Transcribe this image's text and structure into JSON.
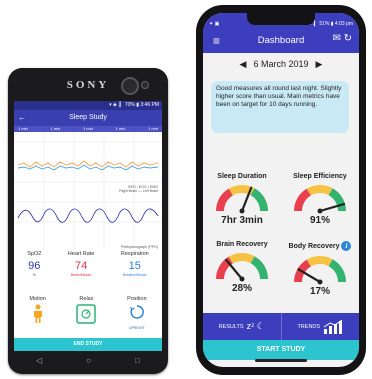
{
  "left_phone": {
    "brand": "SONY",
    "status_time": "▾ ◈ .▎ 70% ▮ 3:46 PM",
    "app_title": "Sleep Study",
    "back_glyph": "←",
    "tab_labels": [
      "1 min",
      "1 min",
      "1 min",
      "1 min",
      "1 min"
    ],
    "legend_line1": "EEG / EOG / EMG",
    "legend_line2": "Right Brain  —  Left Brain",
    "ppg_label": "Plethysmograph (PPG)",
    "metrics": [
      {
        "label": "SpO2",
        "value": "96",
        "unit": "%",
        "color": "#2e3aa8"
      },
      {
        "label": "Heart Rate",
        "value": "74",
        "unit": "Beats/Minute",
        "color": "#e0334a"
      },
      {
        "label": "Respiration",
        "value": "15",
        "unit": "Breaths/Minute",
        "color": "#2e7dd6"
      }
    ],
    "icons": [
      {
        "label": "Motion",
        "sub": ""
      },
      {
        "label": "Relax",
        "sub": ""
      },
      {
        "label": "Position",
        "sub": "UPRIGHT"
      }
    ],
    "end_button": "END STUDY",
    "nav": [
      "◁",
      "○",
      "□"
    ]
  },
  "right_phone": {
    "status_left": "✦ ▣",
    "status_right": "✶ ▾ .▎ 51% ▮ 4:03 pm",
    "menu_glyph": "≡",
    "header_title": "Dashboard",
    "header_icons": "✉ ↻",
    "date_prev": "◀",
    "date_label": "6 March 2019",
    "date_next": "▶",
    "summary": "Good measures all round last night. Slightly higher score than usual. Main metrics have been on target for 10 days running.",
    "gauges": [
      {
        "label": "Sleep Duration",
        "value": "7hr 3min",
        "level": 0.62
      },
      {
        "label": "Sleep Efficiency",
        "value": "91%",
        "level": 0.91
      },
      {
        "label": "Brain Recovery",
        "value": "28%",
        "level": 0.28
      },
      {
        "label": "Body Recovery",
        "value": "17%",
        "level": 0.17
      }
    ],
    "info_glyph": "i",
    "results_label": "RESULTS",
    "results_icon": "zᶻ ☾",
    "trends_label": "TRENDS",
    "start_button": "START STUDY"
  }
}
